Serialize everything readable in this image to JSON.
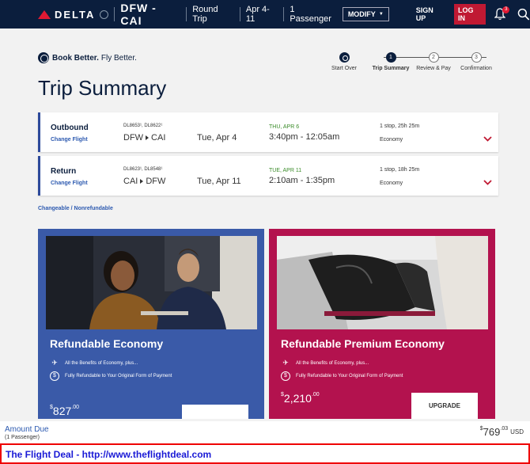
{
  "header": {
    "brand": "DELTA",
    "route": "DFW - CAI",
    "trip_type": "Round Trip",
    "dates": "Apr 4-11",
    "passengers": "1 Passenger",
    "modify": "MODIFY",
    "signup": "SIGN UP",
    "login": "LOG IN",
    "notification_count": "3"
  },
  "book_better": {
    "bold": "Book Better.",
    "rest": "Fly Better."
  },
  "steps": [
    {
      "label": "Start Over",
      "number": ""
    },
    {
      "label": "Trip Summary",
      "number": "1"
    },
    {
      "label": "Review & Pay",
      "number": "2"
    },
    {
      "label": "Confirmation",
      "number": "3"
    }
  ],
  "page_title": "Trip Summary",
  "flights": [
    {
      "type": "Outbound",
      "change": "Change Flight",
      "flight_numbers": "DL8653¹, DL8622¹",
      "from": "DFW",
      "to": "CAI",
      "date": "Tue, Apr 4",
      "arrival_day": "THU, APR 6",
      "times": "3:40pm - 12:05am",
      "stops": "1 stop, 25h 25m",
      "cabin": "Economy"
    },
    {
      "type": "Return",
      "change": "Change Flight",
      "flight_numbers": "DL8623¹, DL8548¹",
      "from": "CAI",
      "to": "DFW",
      "date": "Tue, Apr 11",
      "arrival_day": "TUE, APR 11",
      "times": "2:10am - 1:35pm",
      "stops": "1 stop, 18h 25m",
      "cabin": "Economy"
    }
  ],
  "changeable": "Changeable / Nonrefundable",
  "fares": [
    {
      "title": "Refundable Economy",
      "benefits": [
        "All the Benefits of Economy, plus...",
        "Fully Refundable to Your Original Form of Payment"
      ],
      "price_sup": "$",
      "price": "827",
      "price_cents": ".00"
    },
    {
      "title": "Refundable Premium Economy",
      "benefits": [
        "All the Benefits of Economy, plus...",
        "Fully Refundable to Your Original Form of Payment"
      ],
      "price_sup": "$",
      "price": "2,210",
      "price_cents": ".00",
      "button": "UPGRADE"
    }
  ],
  "amount_due": {
    "label": "Amount Due",
    "passengers": "(1 Passenger)",
    "sup": "$",
    "price": "769",
    "cents": ".03",
    "currency": "USD"
  },
  "watermark": "The Flight Deal - http://www.theflightdeal.com",
  "colors": {
    "navy": "#0b1e3d",
    "delta_red": "#e01933",
    "economy_card": "#3a5aa8",
    "premium_card": "#b3124e",
    "link_blue": "#2d5ab0"
  }
}
